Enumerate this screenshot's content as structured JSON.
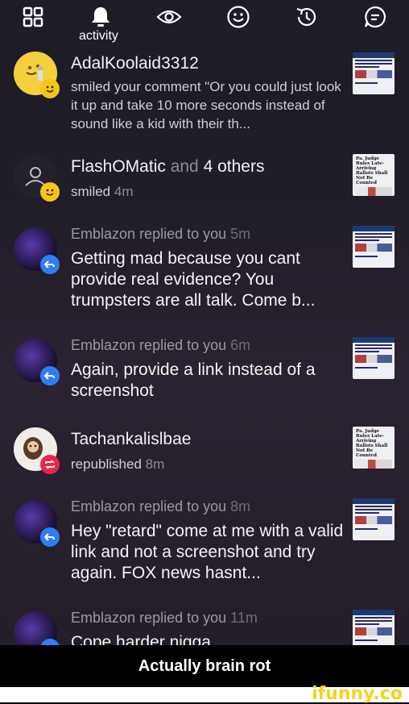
{
  "topbar": {
    "icons": [
      "grid-icon",
      "bell-icon",
      "eye-icon",
      "smiley-icon",
      "history-icon",
      "chat-icon"
    ],
    "active_label": "activity"
  },
  "notifications": [
    {
      "user": "AdalKoolaid3312",
      "action": "smiled your comment \"Or you could just look it up and take 10 more seconds instead of sound like a kid with their th...",
      "badge": "smile",
      "thumb": "news"
    },
    {
      "user": "FlashOMatic",
      "and": "and",
      "others": "4 others",
      "action": "smiled",
      "time": "4m",
      "badge": "smile",
      "thumb": "ruling"
    },
    {
      "user": "Emblazon",
      "action": "replied to you",
      "time": "5m",
      "message": "Getting mad because you cant provide real evidence? You trumpsters are all talk. Come b...",
      "badge": "reply",
      "thumb": "news"
    },
    {
      "user": "Emblazon",
      "action": "replied to you",
      "time": "6m",
      "message": "Again, provide a link instead of a screenshot",
      "badge": "reply",
      "thumb": "news"
    },
    {
      "user": "Tachankalislbae",
      "action": "republished",
      "time": "8m",
      "badge": "republish",
      "thumb": "ruling"
    },
    {
      "user": "Emblazon",
      "action": "replied to you",
      "time": "8m",
      "message": "Hey \"retard\" come at me with a valid link and not a screenshot and try again. FOX news hasnt...",
      "badge": "reply",
      "thumb": "news"
    },
    {
      "user": "Emblazon",
      "action": "replied to you",
      "time": "11m",
      "message": "Cope harder nigga",
      "badge": "reply",
      "thumb": "news"
    }
  ],
  "ruling_thumb_text": "Pa. Judge Rules Late-Arriving Ballots Shall Not Be Counted",
  "caption": "Actually brain rot",
  "watermark": "ifunny.co",
  "colors": {
    "smile_badge": "#f5c518",
    "reply_badge": "#2f7cf6",
    "republish_badge": "#e8264d",
    "watermark": "#f6d21a"
  }
}
